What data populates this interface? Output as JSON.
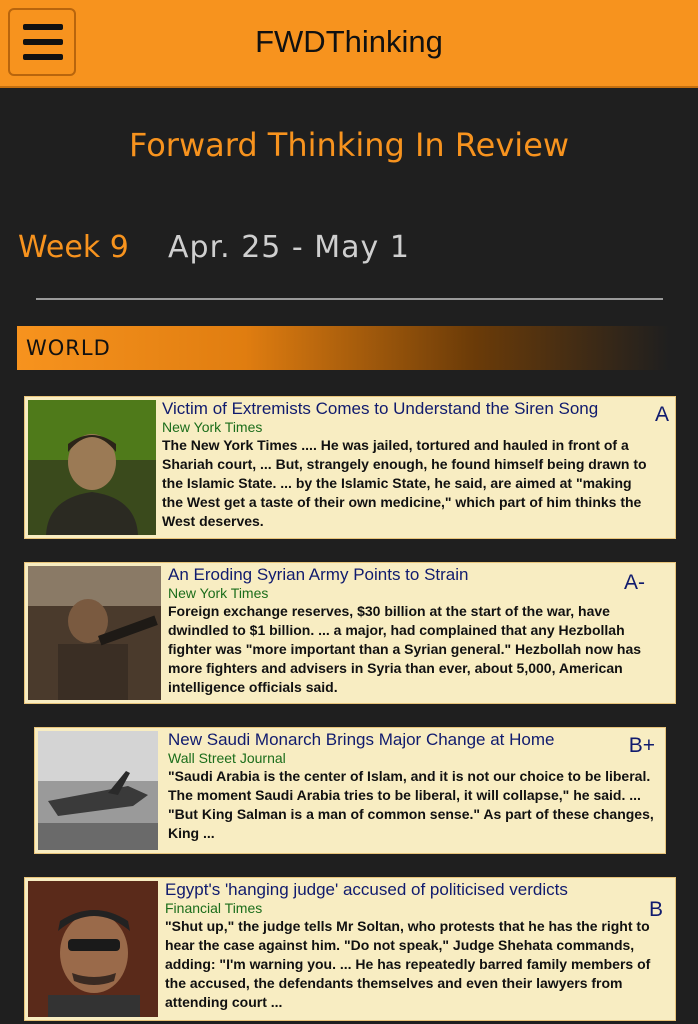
{
  "app": {
    "title": "FWDThinking"
  },
  "page": {
    "title": "Forward Thinking In Review",
    "week": "Week 9",
    "date_range": "Apr. 25 - May 1"
  },
  "section": {
    "title": "WORLD"
  },
  "articles": [
    {
      "headline": "Victim of Extremists Comes to Understand the Siren Song",
      "source": "New York Times",
      "snippet": "The New York Times .... He was jailed, tortured and hauled in front of a Shariah court, ... But, strangely enough, he found himself being drawn to the Islamic State. ... by the Islamic State, he said, are aimed at \"making the West get a taste of their own medicine,\" which part of him thinks the West deserves.",
      "grade": "A"
    },
    {
      "headline": "An Eroding Syrian Army Points to Strain",
      "source": "New York Times",
      "snippet": "Foreign exchange reserves, $30 billion at the start of the war, have dwindled to $1 billion. ... a major, had complained that any Hezbollah fighter was \"more important than a Syrian general.\" Hezbollah now has more fighters and advisers in Syria than ever, about 5,000, American intelligence officials said.",
      "grade": "A-"
    },
    {
      "headline": "New Saudi Monarch Brings Major Change at Home",
      "source": "Wall Street Journal",
      "snippet": "\"Saudi Arabia is the center of Islam, and it is not our choice to be liberal. The moment Saudi Arabia tries to be liberal, it will collapse,\" he said. ... \"But King Salman is a man of common sense.\" As part of these changes, King ...",
      "grade": "B+"
    },
    {
      "headline": "Egypt's 'hanging judge' accused of politicised verdicts",
      "source": "Financial Times",
      "snippet": "\"Shut up,\" the judge tells Mr Soltan, who protests that he has the right to hear the case against him. \"Do not speak,\" Judge Shehata commands, adding: \"I'm warning you. ... He has repeatedly barred family members of the accused, the defendants themselves and even their lawyers from attending court ...",
      "grade": "B"
    }
  ],
  "colors": {
    "accent": "#f7931e",
    "background": "#1f1f1f",
    "card": "#f8edc2"
  }
}
